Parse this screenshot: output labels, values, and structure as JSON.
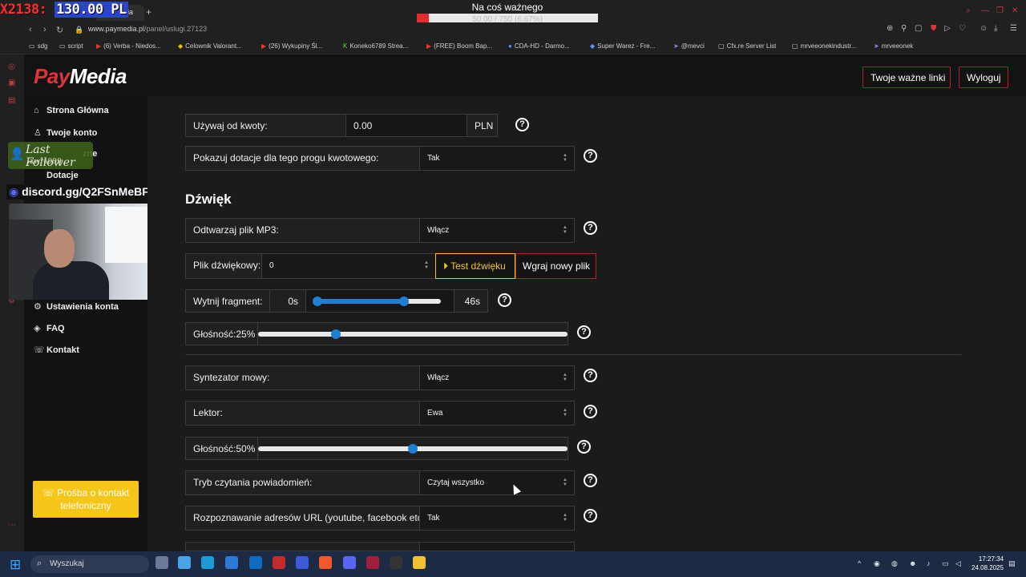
{
  "overlay": {
    "pl_counter": "X2138:",
    "pl_amount": "130.00 PL",
    "follower_title": "Last Follower",
    "follower_name": "lawra999",
    "discord": "discord.gg/Q2FSnMeBFZ"
  },
  "goal": {
    "title": "Na coś ważnego",
    "progress_text": "50.00 / 750 (6.67%)",
    "progress_pct": 6.67,
    "fill_color": "#e52b2b"
  },
  "browser": {
    "tab_title": "PayMedia",
    "url_host": "www.paymedia.pl",
    "url_path": "/panel/uslugi.27123"
  },
  "bookmarks": [
    "sdg",
    "script",
    "(6) Verba - Niedos...",
    "Celownik Valorant...",
    "(26) Wykupiny Śl...",
    "Koneko6789 Strea...",
    "(FREE) Boom Bap...",
    "CDA-HD - Darmo...",
    "Super Warez - Fre...",
    "@mevci",
    "Cfx.re Server List",
    "mrveeonekindustr...",
    "mrveeonek"
  ],
  "header": {
    "logo_pay": "Pay",
    "logo_media": "Media",
    "important_links": "Twoje ważne linki",
    "logout": "Wyloguj",
    "accent": "#e0323a"
  },
  "sidebar": {
    "items": [
      {
        "label": "Strona Główna",
        "icon": "home-icon"
      },
      {
        "label": "Twoje konto",
        "icon": "user-icon"
      },
      {
        "label": "zne",
        "icon": "cart-icon"
      },
      {
        "label": "Dotacje",
        "icon": "gift-icon"
      },
      {
        "label": "Ustawienia konta",
        "icon": "gear-icon"
      },
      {
        "label": "FAQ",
        "icon": "layers-icon"
      },
      {
        "label": "Kontakt",
        "icon": "phone-icon"
      }
    ],
    "call_button": "Prośba o kontakt telefoniczny"
  },
  "form": {
    "min_amount_label": "Używaj od kwoty:",
    "min_amount_value": "0.00",
    "currency": "PLN",
    "show_donations_label": "Pokazuj dotacje dla tego progu kwotowego:",
    "show_donations_value": "Tak",
    "sound_section": "Dźwięk",
    "play_mp3_label": "Odtwarzaj plik MP3:",
    "play_mp3_value": "Włącz",
    "sound_file_label": "Plik dźwiękowy:",
    "sound_file_value": "0",
    "test_sound_button": "Test dźwięku",
    "upload_button": "Wgraj nowy plik",
    "cut_label": "Wytnij fragment:",
    "cut_start": "0s",
    "cut_end": "46s",
    "cut_range_start": 0,
    "cut_range_end": 0.7,
    "volume1_label": "Głośność:25%",
    "volume1_value": 25,
    "tts_label": "Syntezator mowy:",
    "tts_value": "Włącz",
    "reader_label": "Lektor:",
    "reader_value": "Ewa",
    "volume2_label": "Głośność:50%",
    "volume2_value": 50,
    "read_mode_label": "Tryb czytania powiadomień:",
    "read_mode_value": "Czytaj wszystko",
    "url_recognition_label": "Rozpoznawanie adresów URL (youtube, facebook etc.):",
    "url_recognition_value": "Tak"
  },
  "taskbar": {
    "search_placeholder": "Wyszukaj",
    "time": "17:27:34",
    "date": "24.08.2025"
  }
}
